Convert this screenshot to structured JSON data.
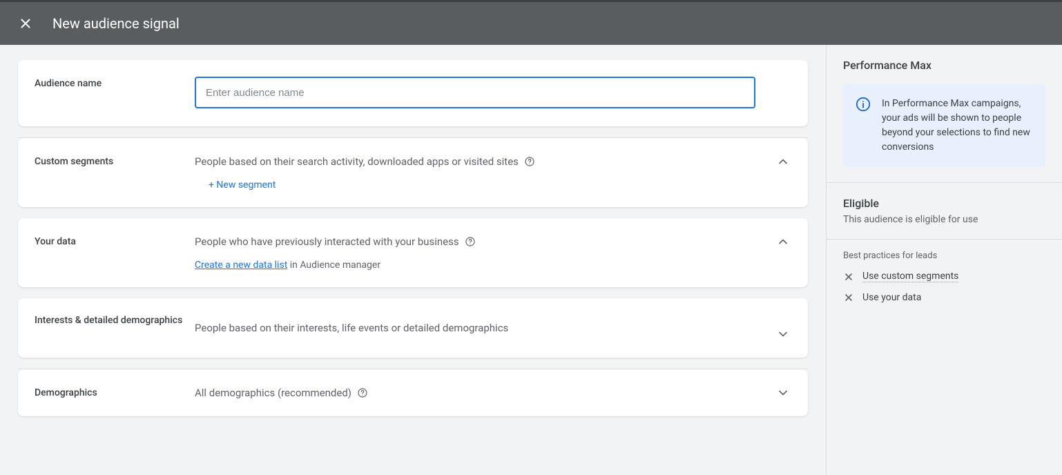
{
  "header": {
    "title": "New audience signal"
  },
  "cards": {
    "audienceName": {
      "label": "Audience name",
      "placeholder": "Enter audience name"
    },
    "customSegments": {
      "label": "Custom segments",
      "desc": "People based on their search activity, downloaded apps or visited sites",
      "action": "+ New segment"
    },
    "yourData": {
      "label": "Your data",
      "desc": "People who have previously interacted with your business",
      "actionLink": "Create a new data list",
      "actionSuffix": " in Audience manager"
    },
    "interests": {
      "label": "Interests & detailed demographics",
      "desc": "People based on their interests, life events or detailed demographics"
    },
    "demographics": {
      "label": "Demographics",
      "desc": "All demographics (recommended)"
    }
  },
  "sidebar": {
    "topHeading": "Performance Max",
    "infoText": "In Performance Max campaigns, your ads will be shown to people beyond your selections to find new conversions",
    "eligible": {
      "heading": "Eligible",
      "text": "This audience is eligible for use"
    },
    "bestPractices": {
      "heading": "Best practices for leads",
      "items": [
        "Use custom segments",
        "Use your data"
      ]
    }
  }
}
